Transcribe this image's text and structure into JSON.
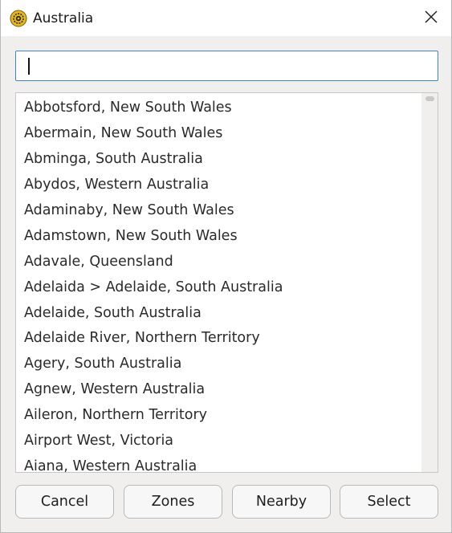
{
  "window": {
    "title": "Australia",
    "app_icon": "sun-gear-icon",
    "close_icon": "close-icon"
  },
  "search": {
    "value": "",
    "placeholder": ""
  },
  "locations": [
    "Abbotsford, New South Wales",
    "Abermain, New South Wales",
    "Abminga, South Australia",
    "Abydos, Western Australia",
    "Adaminaby, New South Wales",
    "Adamstown, New South Wales",
    "Adavale, Queensland",
    "Adelaida > Adelaide, South Australia",
    "Adelaide, South Australia",
    "Adelaide River, Northern Territory",
    "Agery, South Australia",
    "Agnew, Western Australia",
    "Aileron, Northern Territory",
    "Airport West, Victoria",
    "Aiana, Western Australia"
  ],
  "buttons": {
    "cancel": "Cancel",
    "zones": "Zones",
    "nearby": "Nearby",
    "select": "Select"
  },
  "colors": {
    "accent": "#3b87d6",
    "window_bg": "#f0efee",
    "icon_yellow": "#e5b81c"
  }
}
